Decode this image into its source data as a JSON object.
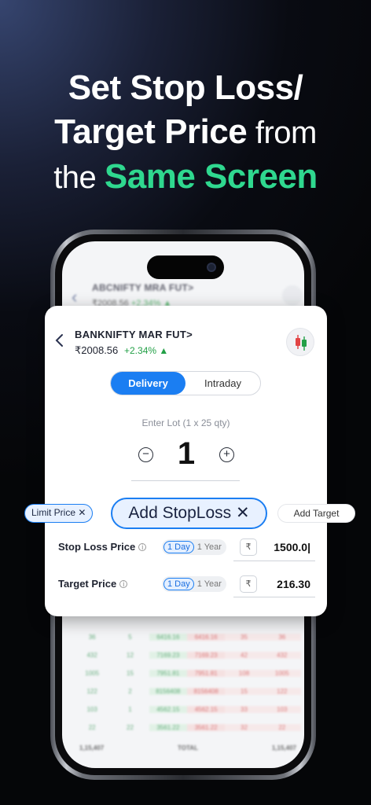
{
  "headline": {
    "line1": "Set Stop Loss/",
    "line2_bold": "Target Price",
    "line2_light": " from",
    "line3_light": "the ",
    "line3_green": "Same Screen"
  },
  "background_screen": {
    "instrument": "ABCNIFTY MRA FUT>",
    "price": "₹2008.56",
    "change": "+2.34% ▲",
    "table_rows": [
      [
        "36",
        "5",
        "6416.16",
        "6416.16",
        "35",
        "36"
      ],
      [
        "432",
        "12",
        "7169.23",
        "7169.23",
        "42",
        "432"
      ],
      [
        "1005",
        "15",
        "7951.81",
        "7951.81",
        "108",
        "1005"
      ],
      [
        "122",
        "2",
        "8156408",
        "8156408",
        "15",
        "122"
      ],
      [
        "103",
        "1",
        "4562.15",
        "4562.15",
        "33",
        "103"
      ],
      [
        "22",
        "22",
        "3561.22",
        "3561.22",
        "32",
        "22"
      ]
    ],
    "footer": [
      "1,15,407",
      "TOTAL",
      "1,15,407"
    ]
  },
  "order": {
    "instrument": "BANKNIFTY MAR FUT>",
    "price": "₹2008.56",
    "change": "+2.34% ▲",
    "tabs": [
      "Delivery",
      "Intraday"
    ],
    "active_tab": "Delivery",
    "lot_label": "Enter Lot (1 x 25 qty)",
    "lot_value": "1",
    "stop_loss": {
      "label": "Stop Loss Price",
      "opt1": "1 Day",
      "opt2": "1 Year",
      "currency": "₹",
      "value": "1500.0|"
    },
    "target": {
      "label": "Target Price",
      "opt1": "1 Day",
      "opt2": "1 Year",
      "currency": "₹",
      "value": "216.30"
    }
  },
  "chips": {
    "limit": "Limit Price ✕",
    "stoploss": "Add StopLoss ✕",
    "target": "Add Target"
  },
  "colors": {
    "accent": "#1b7ef2",
    "green": "#2fd88f",
    "up": "#23a047"
  }
}
